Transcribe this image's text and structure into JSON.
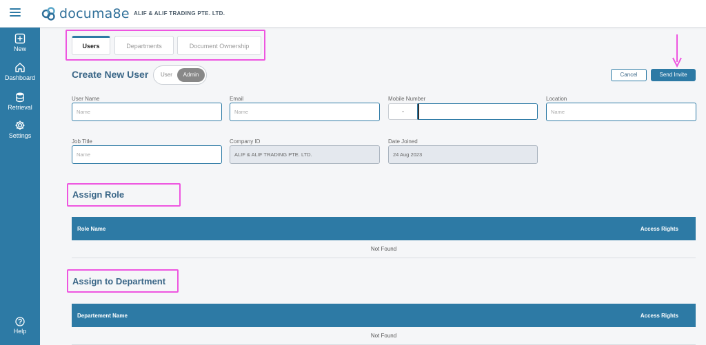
{
  "header": {
    "brand": "documa8e",
    "company": "ALIF & ALIF TRADING PTE. LTD."
  },
  "sidebar": {
    "items": [
      {
        "label": "New",
        "icon": "plus-square-icon"
      },
      {
        "label": "Dashboard",
        "icon": "home-icon"
      },
      {
        "label": "Retrieval",
        "icon": "database-icon"
      },
      {
        "label": "Settings",
        "icon": "gear-icon"
      }
    ],
    "help": {
      "label": "Help",
      "icon": "help-circle-icon"
    }
  },
  "tabs": [
    {
      "label": "Users",
      "active": true
    },
    {
      "label": "Departments",
      "active": false
    },
    {
      "label": "Document Ownership",
      "active": false
    }
  ],
  "page": {
    "title": "Create New User",
    "toggle": {
      "user": "User",
      "admin": "Admin",
      "selected": "Admin"
    },
    "cancel": "Cancel",
    "send": "Send Invite"
  },
  "form": {
    "user_name": {
      "label": "User Name",
      "placeholder": "Name"
    },
    "email": {
      "label": "Email",
      "placeholder": "Name"
    },
    "mobile": {
      "label": "Mobile Number",
      "code": "⌄"
    },
    "location": {
      "label": "Location",
      "placeholder": "Name"
    },
    "job_title": {
      "label": "Job Title",
      "placeholder": "Name"
    },
    "company_id": {
      "label": "Company ID",
      "value": "ALIF & ALIF TRADING PTE. LTD."
    },
    "date_joined": {
      "label": "Date Joined",
      "value": "24 Aug 2023"
    }
  },
  "assign_role": {
    "title": "Assign Role",
    "col1": "Role Name",
    "col2": "Access Rights",
    "empty": "Not Found"
  },
  "assign_department": {
    "title": "Assign to Department",
    "col1": "Departement Name",
    "col2": "Access Rights",
    "empty": "Not Found"
  },
  "colors": {
    "accent": "#2d7aa5",
    "highlight": "#ee55e0",
    "title": "#3a6687"
  }
}
